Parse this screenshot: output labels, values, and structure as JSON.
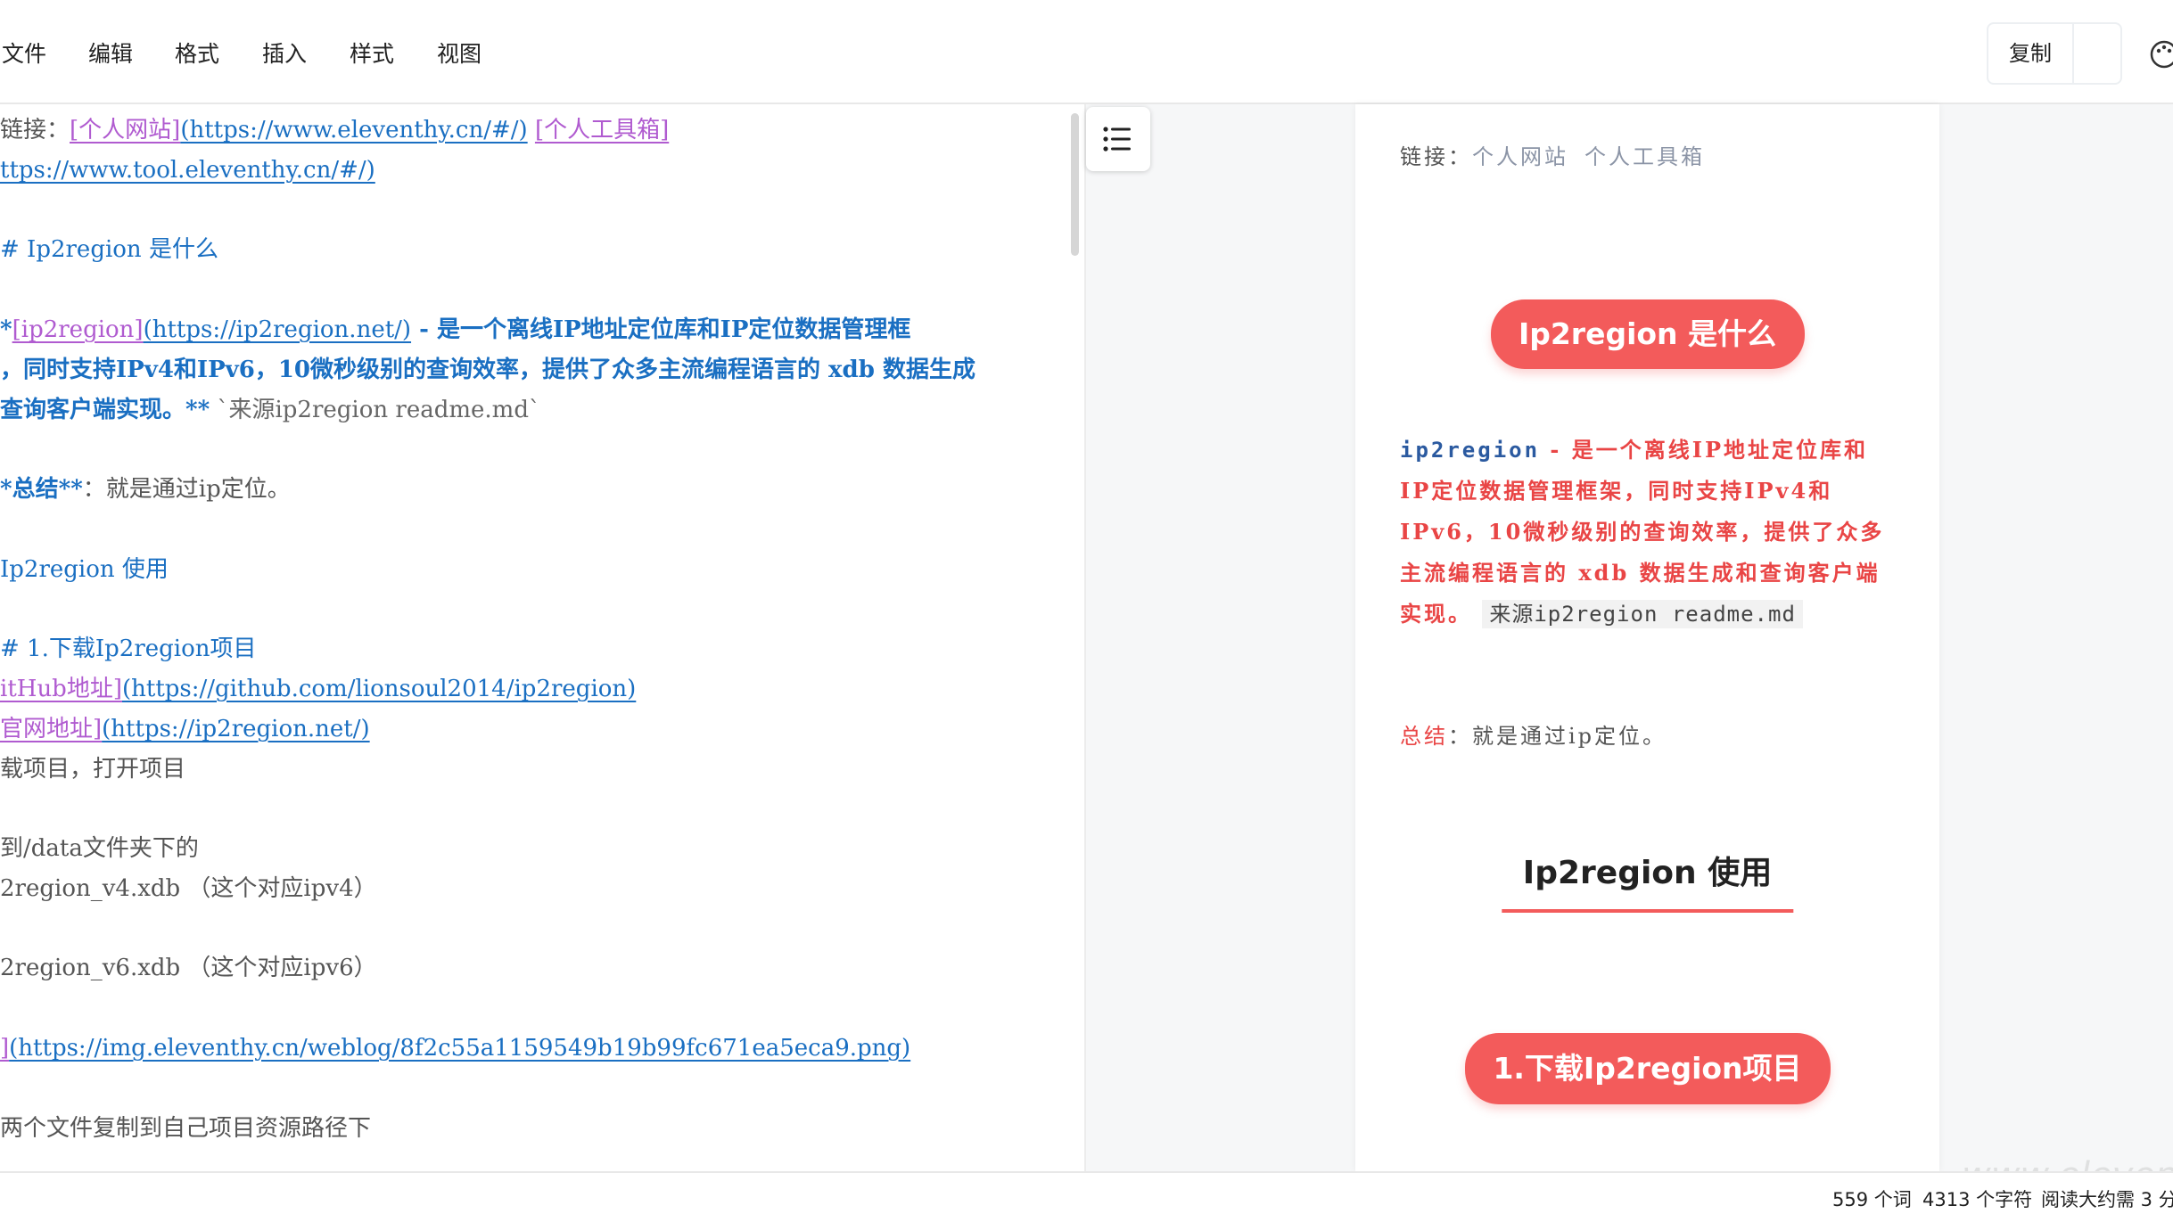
{
  "menubar": {
    "items": [
      "文件",
      "编辑",
      "格式",
      "插入",
      "样式",
      "视图"
    ],
    "copy_label": "复制"
  },
  "editor": {
    "lines": [
      {
        "parts": [
          {
            "t": "链接：",
            "c": "plain"
          },
          {
            "t": "[个人网站]",
            "c": "lk"
          },
          {
            "t": "(https://www.eleventhy.cn/#/)",
            "c": "url"
          },
          {
            "t": " ",
            "c": "plain"
          },
          {
            "t": "[个人工具箱]",
            "c": "lk"
          }
        ]
      },
      {
        "parts": [
          {
            "t": "ttps://www.tool.eleventhy.cn/#/)",
            "c": "url"
          }
        ]
      },
      {
        "parts": [
          {
            "t": "# Ip2region 是什么",
            "c": "hd"
          }
        ]
      },
      {
        "parts": [
          {
            "t": "*",
            "c": "bd"
          },
          {
            "t": "[ip2region]",
            "c": "lk"
          },
          {
            "t": "(https://ip2region.net/)",
            "c": "url"
          },
          {
            "t": " - 是一个离线IP地址定位库和IP定位数据管理框",
            "c": "bd"
          }
        ]
      },
      {
        "parts": [
          {
            "t": "，同时支持IPv4和IPv6，10微秒级别的查询效率，提供了众多主流编程语言的 xdb 数据生成",
            "c": "bd"
          }
        ]
      },
      {
        "parts": [
          {
            "t": "查询客户端实现。**",
            "c": "bd"
          },
          {
            "t": " `来源ip2region readme.md`",
            "c": "code"
          }
        ]
      },
      {
        "parts": [
          {
            "t": "*总结**",
            "c": "bd"
          },
          {
            "t": "：就是通过ip定位。",
            "c": "plain"
          }
        ]
      },
      {
        "parts": [
          {
            "t": " Ip2region 使用",
            "c": "hd"
          }
        ]
      },
      {
        "parts": [
          {
            "t": "# 1.下载Ip2region项目",
            "c": "hd"
          }
        ]
      },
      {
        "parts": [
          {
            "t": "itHub地址]",
            "c": "lk"
          },
          {
            "t": "(https://github.com/lionsoul2014/ip2region)",
            "c": "url"
          }
        ]
      },
      {
        "parts": [
          {
            "t": "官网地址]",
            "c": "lk"
          },
          {
            "t": "(https://ip2region.net/)",
            "c": "url"
          }
        ]
      },
      {
        "parts": [
          {
            "t": "载项目，打开项目",
            "c": "plain"
          }
        ]
      },
      {
        "parts": [
          {
            "t": "到/data文件夹下的",
            "c": "plain"
          }
        ]
      },
      {
        "parts": [
          {
            "t": "2region_v4.xdb  （这个对应ipv4）",
            "c": "plain"
          }
        ]
      },
      {
        "parts": [
          {
            "t": "2region_v6.xdb  （这个对应ipv6）",
            "c": "plain"
          }
        ]
      },
      {
        "parts": [
          {
            "t": "]",
            "c": "lk"
          },
          {
            "t": "(https://img.eleventhy.cn/weblog/8f2c55a1159549b19b99fc671ea5eca9.png)",
            "c": "url"
          }
        ]
      },
      {
        "parts": [
          {
            "t": "两个文件复制到自己项目资源路径下",
            "c": "plain"
          }
        ]
      }
    ]
  },
  "preview": {
    "links_prefix": "链接：",
    "link1": "个人网站",
    "link2": "个人工具箱",
    "h1_title": "Ip2region 是什么",
    "para_mono": "ip2region",
    "para_text": " - 是一个离线IP地址定位库和IP定位数据管理框架，同时支持IPv4和IPv6，10微秒级别的查询效率，提供了众多主流编程语言的 xdb 数据生成和查询客户端实现。",
    "para_code": "来源ip2region readme.md",
    "summary_label": "总结",
    "summary_text": "：就是通过ip定位。",
    "h2_title": "Ip2region 使用",
    "h3_title": "1.下载Ip2region项目"
  },
  "status": {
    "words": "559 个词",
    "chars": "4313 个字符",
    "read_time": "阅读大约需 3 分"
  },
  "watermark": "www.eleventhy.cn",
  "colors": {
    "accent_red": "#f35b5b",
    "link_purple": "#b05bd0",
    "url_blue": "#1a6fc2"
  }
}
